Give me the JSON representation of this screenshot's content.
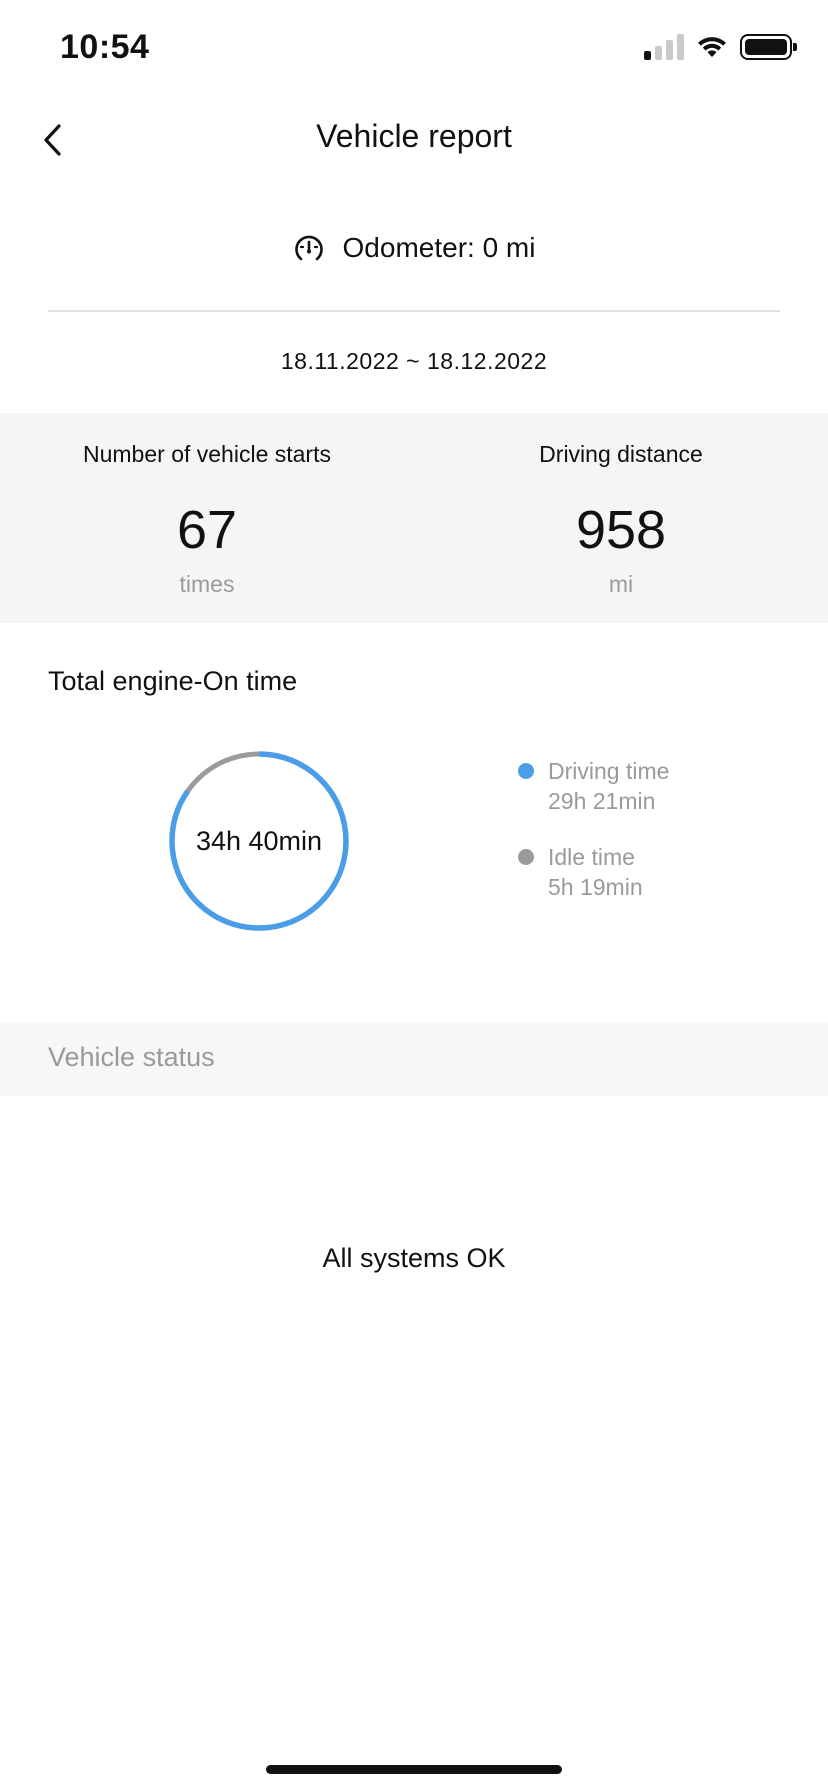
{
  "status_bar": {
    "time": "10:54"
  },
  "header": {
    "title": "Vehicle report"
  },
  "odometer": {
    "label": "Odometer: 0 mi",
    "icon": "speedometer-icon"
  },
  "date_range": "18.11.2022 ~ 18.12.2022",
  "stats": {
    "starts": {
      "label": "Number of vehicle starts",
      "value": "67",
      "unit": "times"
    },
    "distance": {
      "label": "Driving distance",
      "value": "958",
      "unit": "mi"
    }
  },
  "engine": {
    "title": "Total engine-On time",
    "total": "34h 40min",
    "legend": [
      {
        "label": "Driving time",
        "value": "29h 21min",
        "color": "#4a9de6",
        "minutes": 1761
      },
      {
        "label": "Idle time",
        "value": "5h 19min",
        "color": "#9b9b9b",
        "minutes": 319
      }
    ]
  },
  "vehicle_status": {
    "title": "Vehicle status",
    "message": "All systems OK"
  },
  "colors": {
    "accent": "#4a9de6",
    "secondary": "#9b9b9b",
    "band": "#f5f5f5"
  }
}
